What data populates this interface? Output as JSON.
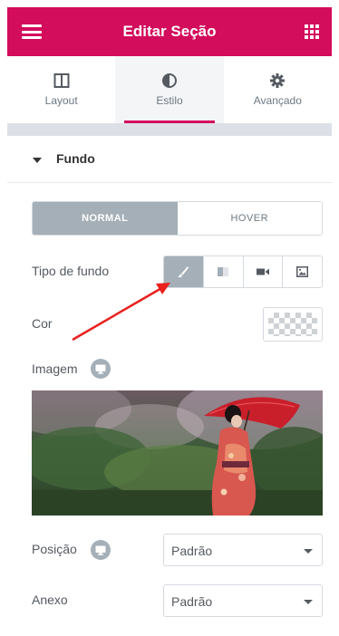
{
  "header": {
    "title": "Editar Seção",
    "menu_icon": "hamburger-icon",
    "apps_icon": "grid-icon",
    "bg_color": "#d30c5c"
  },
  "tabs": [
    {
      "label": "Layout",
      "icon": "layout-columns-icon",
      "active": false
    },
    {
      "label": "Estilo",
      "icon": "contrast-half-circle-icon",
      "active": true
    },
    {
      "label": "Avançado",
      "icon": "gear-icon",
      "active": false
    }
  ],
  "section": {
    "title": "Fundo",
    "expanded": true
  },
  "state_switch": {
    "normal": "NORMAL",
    "hover": "HOVER",
    "selected": "NORMAL"
  },
  "background": {
    "type_label": "Tipo de fundo",
    "type_options": [
      "brush-icon",
      "gradient-icon",
      "video-icon",
      "slideshow-icon"
    ],
    "selected_type": "brush-icon",
    "color_label": "Cor",
    "image_label": "Imagem",
    "position": {
      "label": "Posição",
      "value": "Padrão"
    },
    "attachment": {
      "label": "Anexo",
      "value": "Padrão"
    }
  },
  "colors": {
    "accent": "#d30c5c",
    "control_active": "#a4afb7",
    "annotation_arrow": "#e8201e"
  }
}
